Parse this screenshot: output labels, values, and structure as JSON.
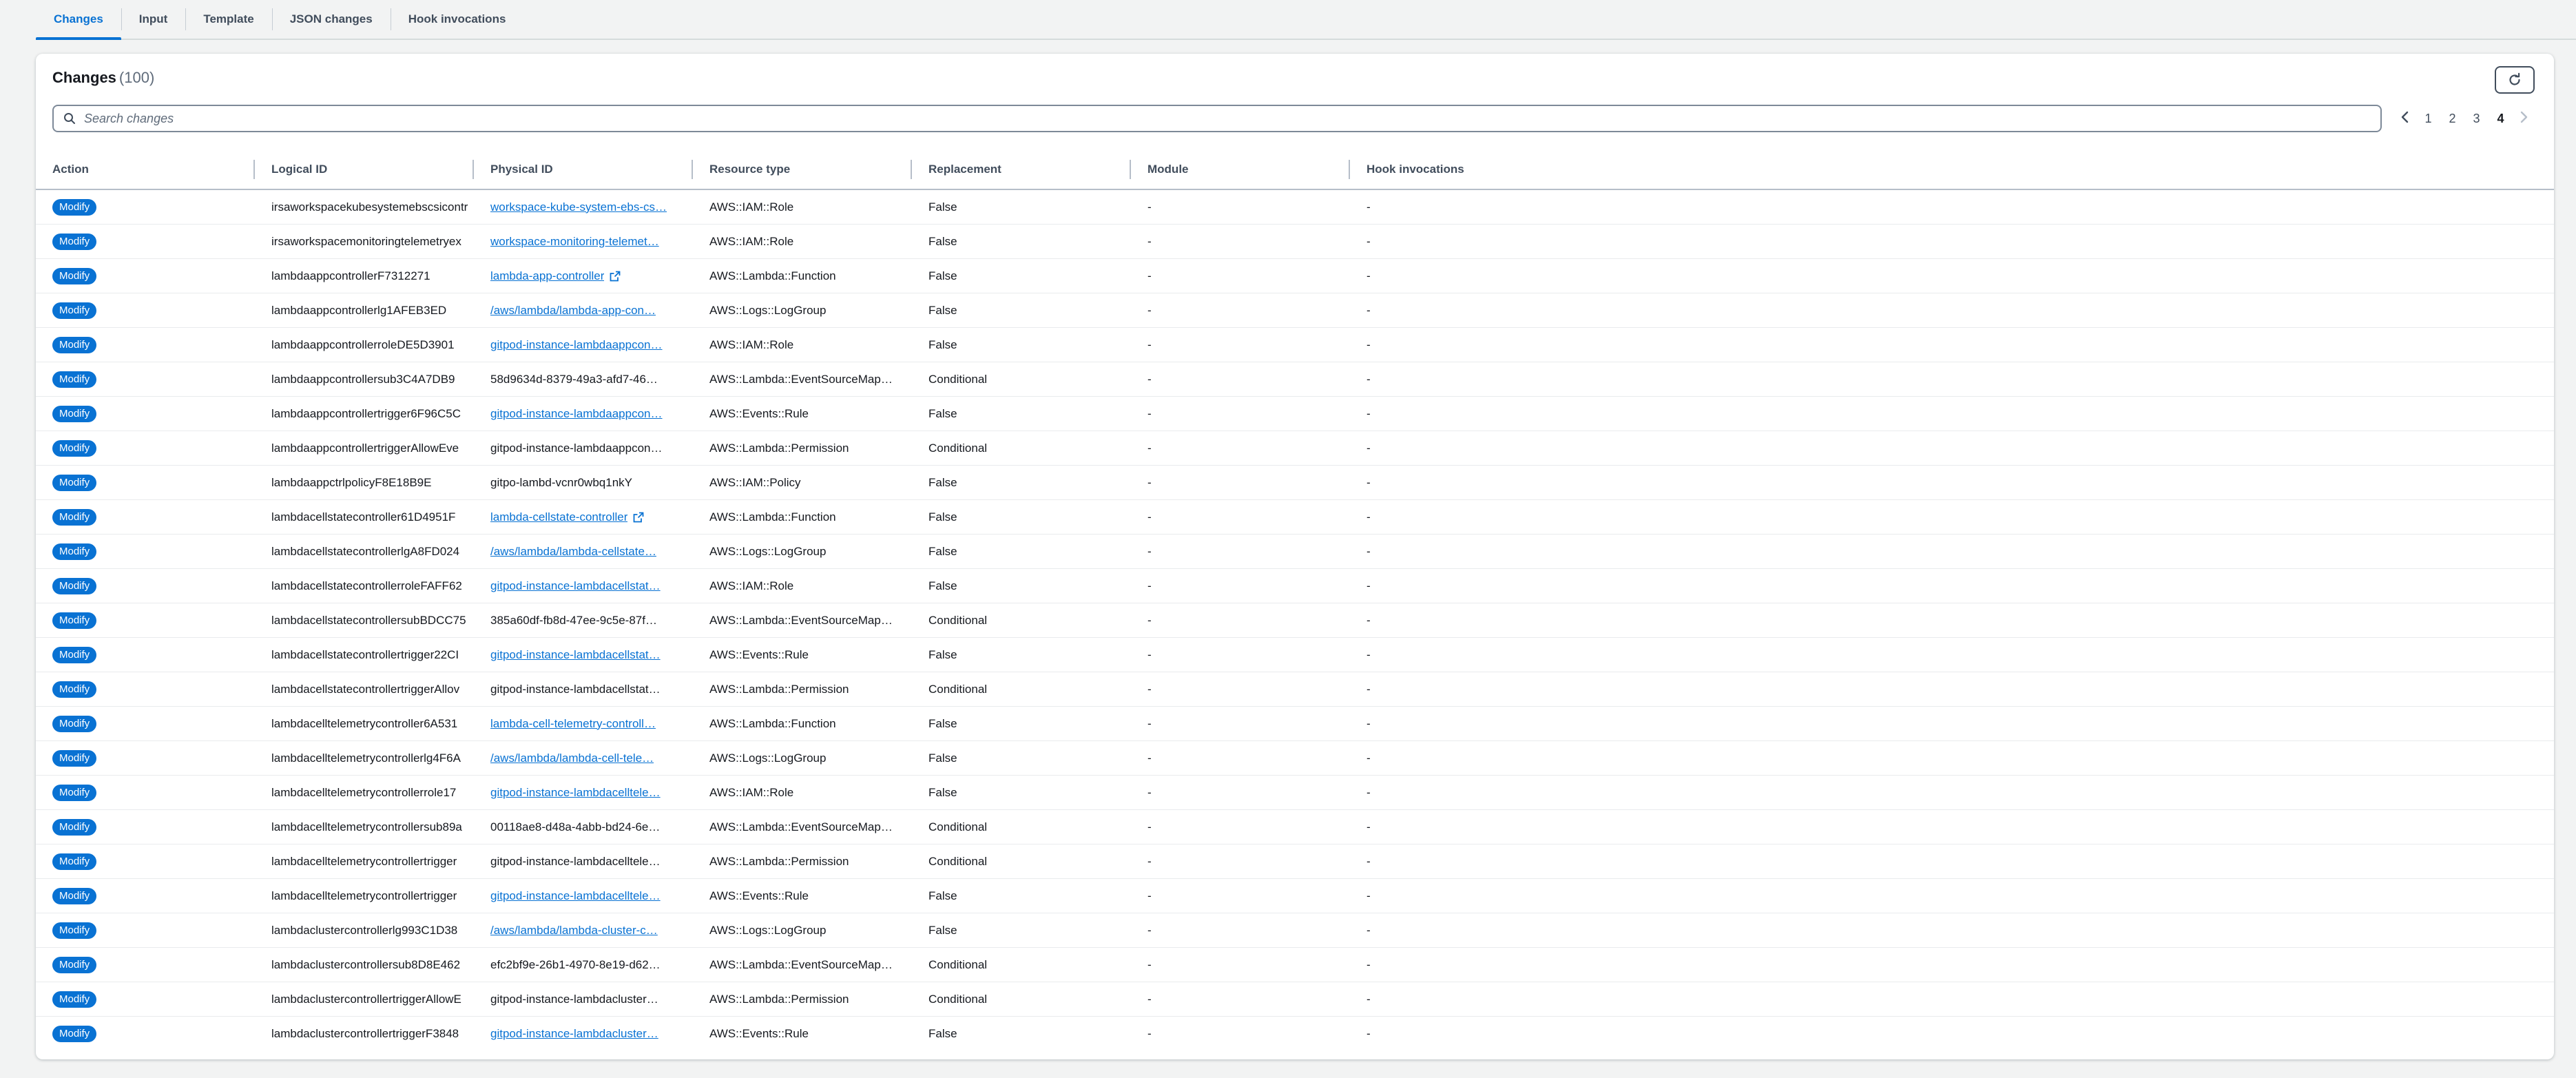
{
  "tabs": [
    {
      "label": "Changes",
      "active": true
    },
    {
      "label": "Input",
      "active": false
    },
    {
      "label": "Template",
      "active": false
    },
    {
      "label": "JSON changes",
      "active": false
    },
    {
      "label": "Hook invocations",
      "active": false
    }
  ],
  "panel": {
    "title": "Changes",
    "count": "(100)",
    "search_placeholder": "Search changes"
  },
  "pagination": {
    "pages": [
      "1",
      "2",
      "3",
      "4"
    ],
    "current": "4"
  },
  "columns": [
    "Action",
    "Logical ID",
    "Physical ID",
    "Resource type",
    "Replacement",
    "Module",
    "Hook invocations"
  ],
  "colors": {
    "accent": "#0972d3"
  },
  "rows": [
    {
      "action": "Modify",
      "logical_id": "irsaworkspacekubesystemebscsicontr",
      "physical_id": "workspace-kube-system-ebs-cs…",
      "physical_link": true,
      "external": false,
      "resource_type": "AWS::IAM::Role",
      "replacement": "False",
      "module": "-",
      "hooks": "-"
    },
    {
      "action": "Modify",
      "logical_id": "irsaworkspacemonitoringtelemetryex",
      "physical_id": "workspace-monitoring-telemet…",
      "physical_link": true,
      "external": false,
      "resource_type": "AWS::IAM::Role",
      "replacement": "False",
      "module": "-",
      "hooks": "-"
    },
    {
      "action": "Modify",
      "logical_id": "lambdaappcontrollerF7312271",
      "physical_id": "lambda-app-controller",
      "physical_link": true,
      "external": true,
      "resource_type": "AWS::Lambda::Function",
      "replacement": "False",
      "module": "-",
      "hooks": "-"
    },
    {
      "action": "Modify",
      "logical_id": "lambdaappcontrollerlg1AFEB3ED",
      "physical_id": "/aws/lambda/lambda-app-con…",
      "physical_link": true,
      "external": false,
      "resource_type": "AWS::Logs::LogGroup",
      "replacement": "False",
      "module": "-",
      "hooks": "-"
    },
    {
      "action": "Modify",
      "logical_id": "lambdaappcontrollerroleDE5D3901",
      "physical_id": "gitpod-instance-lambdaappcon…",
      "physical_link": true,
      "external": false,
      "resource_type": "AWS::IAM::Role",
      "replacement": "False",
      "module": "-",
      "hooks": "-"
    },
    {
      "action": "Modify",
      "logical_id": "lambdaappcontrollersub3C4A7DB9",
      "physical_id": "58d9634d-8379-49a3-afd7-46…",
      "physical_link": false,
      "external": false,
      "resource_type": "AWS::Lambda::EventSourceMap…",
      "replacement": "Conditional",
      "module": "-",
      "hooks": "-"
    },
    {
      "action": "Modify",
      "logical_id": "lambdaappcontrollertrigger6F96C5C",
      "physical_id": "gitpod-instance-lambdaappcon…",
      "physical_link": true,
      "external": false,
      "resource_type": "AWS::Events::Rule",
      "replacement": "False",
      "module": "-",
      "hooks": "-"
    },
    {
      "action": "Modify",
      "logical_id": "lambdaappcontrollertriggerAllowEve",
      "physical_id": "gitpod-instance-lambdaappcon…",
      "physical_link": false,
      "external": false,
      "resource_type": "AWS::Lambda::Permission",
      "replacement": "Conditional",
      "module": "-",
      "hooks": "-"
    },
    {
      "action": "Modify",
      "logical_id": "lambdaappctrlpolicyF8E18B9E",
      "physical_id": "gitpo-lambd-vcnr0wbq1nkY",
      "physical_link": false,
      "external": false,
      "resource_type": "AWS::IAM::Policy",
      "replacement": "False",
      "module": "-",
      "hooks": "-"
    },
    {
      "action": "Modify",
      "logical_id": "lambdacellstatecontroller61D4951F",
      "physical_id": "lambda-cellstate-controller",
      "physical_link": true,
      "external": true,
      "resource_type": "AWS::Lambda::Function",
      "replacement": "False",
      "module": "-",
      "hooks": "-"
    },
    {
      "action": "Modify",
      "logical_id": "lambdacellstatecontrollerlgA8FD024",
      "physical_id": "/aws/lambda/lambda-cellstate…",
      "physical_link": true,
      "external": false,
      "resource_type": "AWS::Logs::LogGroup",
      "replacement": "False",
      "module": "-",
      "hooks": "-"
    },
    {
      "action": "Modify",
      "logical_id": "lambdacellstatecontrollerroleFAFF62",
      "physical_id": "gitpod-instance-lambdacellstat…",
      "physical_link": true,
      "external": false,
      "resource_type": "AWS::IAM::Role",
      "replacement": "False",
      "module": "-",
      "hooks": "-"
    },
    {
      "action": "Modify",
      "logical_id": "lambdacellstatecontrollersubBDCC75",
      "physical_id": "385a60df-fb8d-47ee-9c5e-87f…",
      "physical_link": false,
      "external": false,
      "resource_type": "AWS::Lambda::EventSourceMap…",
      "replacement": "Conditional",
      "module": "-",
      "hooks": "-"
    },
    {
      "action": "Modify",
      "logical_id": "lambdacellstatecontrollertrigger22CI",
      "physical_id": "gitpod-instance-lambdacellstat…",
      "physical_link": true,
      "external": false,
      "resource_type": "AWS::Events::Rule",
      "replacement": "False",
      "module": "-",
      "hooks": "-"
    },
    {
      "action": "Modify",
      "logical_id": "lambdacellstatecontrollertriggerAllov",
      "physical_id": "gitpod-instance-lambdacellstat…",
      "physical_link": false,
      "external": false,
      "resource_type": "AWS::Lambda::Permission",
      "replacement": "Conditional",
      "module": "-",
      "hooks": "-"
    },
    {
      "action": "Modify",
      "logical_id": "lambdacelltelemetrycontroller6A531",
      "physical_id": "lambda-cell-telemetry-controll…",
      "physical_link": true,
      "external": false,
      "resource_type": "AWS::Lambda::Function",
      "replacement": "False",
      "module": "-",
      "hooks": "-"
    },
    {
      "action": "Modify",
      "logical_id": "lambdacelltelemetrycontrollerlg4F6A",
      "physical_id": "/aws/lambda/lambda-cell-tele…",
      "physical_link": true,
      "external": false,
      "resource_type": "AWS::Logs::LogGroup",
      "replacement": "False",
      "module": "-",
      "hooks": "-"
    },
    {
      "action": "Modify",
      "logical_id": "lambdacelltelemetrycontrollerrole17",
      "physical_id": "gitpod-instance-lambdacelltele…",
      "physical_link": true,
      "external": false,
      "resource_type": "AWS::IAM::Role",
      "replacement": "False",
      "module": "-",
      "hooks": "-"
    },
    {
      "action": "Modify",
      "logical_id": "lambdacelltelemetrycontrollersub89a",
      "physical_id": "00118ae8-d48a-4abb-bd24-6e…",
      "physical_link": false,
      "external": false,
      "resource_type": "AWS::Lambda::EventSourceMap…",
      "replacement": "Conditional",
      "module": "-",
      "hooks": "-"
    },
    {
      "action": "Modify",
      "logical_id": "lambdacelltelemetrycontrollertrigger",
      "physical_id": "gitpod-instance-lambdacelltele…",
      "physical_link": false,
      "external": false,
      "resource_type": "AWS::Lambda::Permission",
      "replacement": "Conditional",
      "module": "-",
      "hooks": "-"
    },
    {
      "action": "Modify",
      "logical_id": "lambdacelltelemetrycontrollertrigger",
      "physical_id": "gitpod-instance-lambdacelltele…",
      "physical_link": true,
      "external": false,
      "resource_type": "AWS::Events::Rule",
      "replacement": "False",
      "module": "-",
      "hooks": "-"
    },
    {
      "action": "Modify",
      "logical_id": "lambdaclustercontrollerlg993C1D38",
      "physical_id": "/aws/lambda/lambda-cluster-c…",
      "physical_link": true,
      "external": false,
      "resource_type": "AWS::Logs::LogGroup",
      "replacement": "False",
      "module": "-",
      "hooks": "-"
    },
    {
      "action": "Modify",
      "logical_id": "lambdaclustercontrollersub8D8E462",
      "physical_id": "efc2bf9e-26b1-4970-8e19-d62…",
      "physical_link": false,
      "external": false,
      "resource_type": "AWS::Lambda::EventSourceMap…",
      "replacement": "Conditional",
      "module": "-",
      "hooks": "-"
    },
    {
      "action": "Modify",
      "logical_id": "lambdaclustercontrollertriggerAllowE",
      "physical_id": "gitpod-instance-lambdacluster…",
      "physical_link": false,
      "external": false,
      "resource_type": "AWS::Lambda::Permission",
      "replacement": "Conditional",
      "module": "-",
      "hooks": "-"
    },
    {
      "action": "Modify",
      "logical_id": "lambdaclustercontrollertriggerF3848",
      "physical_id": "gitpod-instance-lambdacluster…",
      "physical_link": true,
      "external": false,
      "resource_type": "AWS::Events::Rule",
      "replacement": "False",
      "module": "-",
      "hooks": "-"
    }
  ]
}
